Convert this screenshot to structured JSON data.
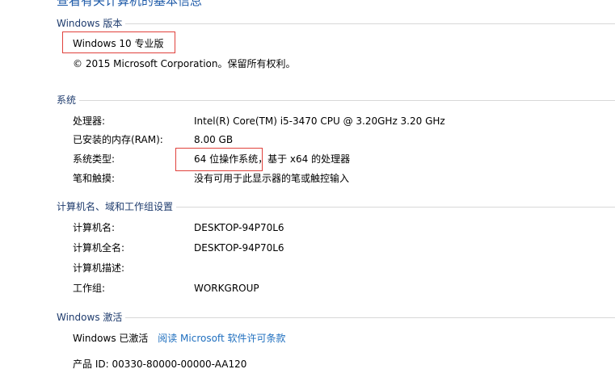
{
  "page_heading": "查看有关计算机的基本信息",
  "windows_edition": {
    "header": "Windows 版本",
    "edition": "Windows 10 专业版",
    "copyright": "© 2015 Microsoft Corporation。保留所有权利。"
  },
  "system": {
    "header": "系统",
    "rows": [
      {
        "label": "处理器:",
        "value": "Intel(R) Core(TM) i5-3470 CPU @ 3.20GHz   3.20 GHz"
      },
      {
        "label": "已安装的内存(RAM):",
        "value": "8.00 GB"
      },
      {
        "label": "系统类型:",
        "value": "64 位操作系统，基于 x64 的处理器"
      },
      {
        "label": "笔和触摸:",
        "value": "没有可用于此显示器的笔或触控输入"
      }
    ]
  },
  "computer_name": {
    "header": "计算机名、域和工作组设置",
    "rows": [
      {
        "label": "计算机名:",
        "value": "DESKTOP-94P70L6"
      },
      {
        "label": "计算机全名:",
        "value": "DESKTOP-94P70L6"
      },
      {
        "label": "计算机描述:",
        "value": ""
      },
      {
        "label": "工作组:",
        "value": "WORKGROUP"
      }
    ]
  },
  "activation": {
    "header": "Windows 激活",
    "status": "Windows 已激活",
    "license_link": "阅读 Microsoft 软件许可条款",
    "product_id": "产品 ID: 00330-80000-00000-AA120"
  },
  "colors": {
    "section_header": "#1f3c6e",
    "link": "#1f6fbf",
    "highlight_border": "#e0413c"
  }
}
